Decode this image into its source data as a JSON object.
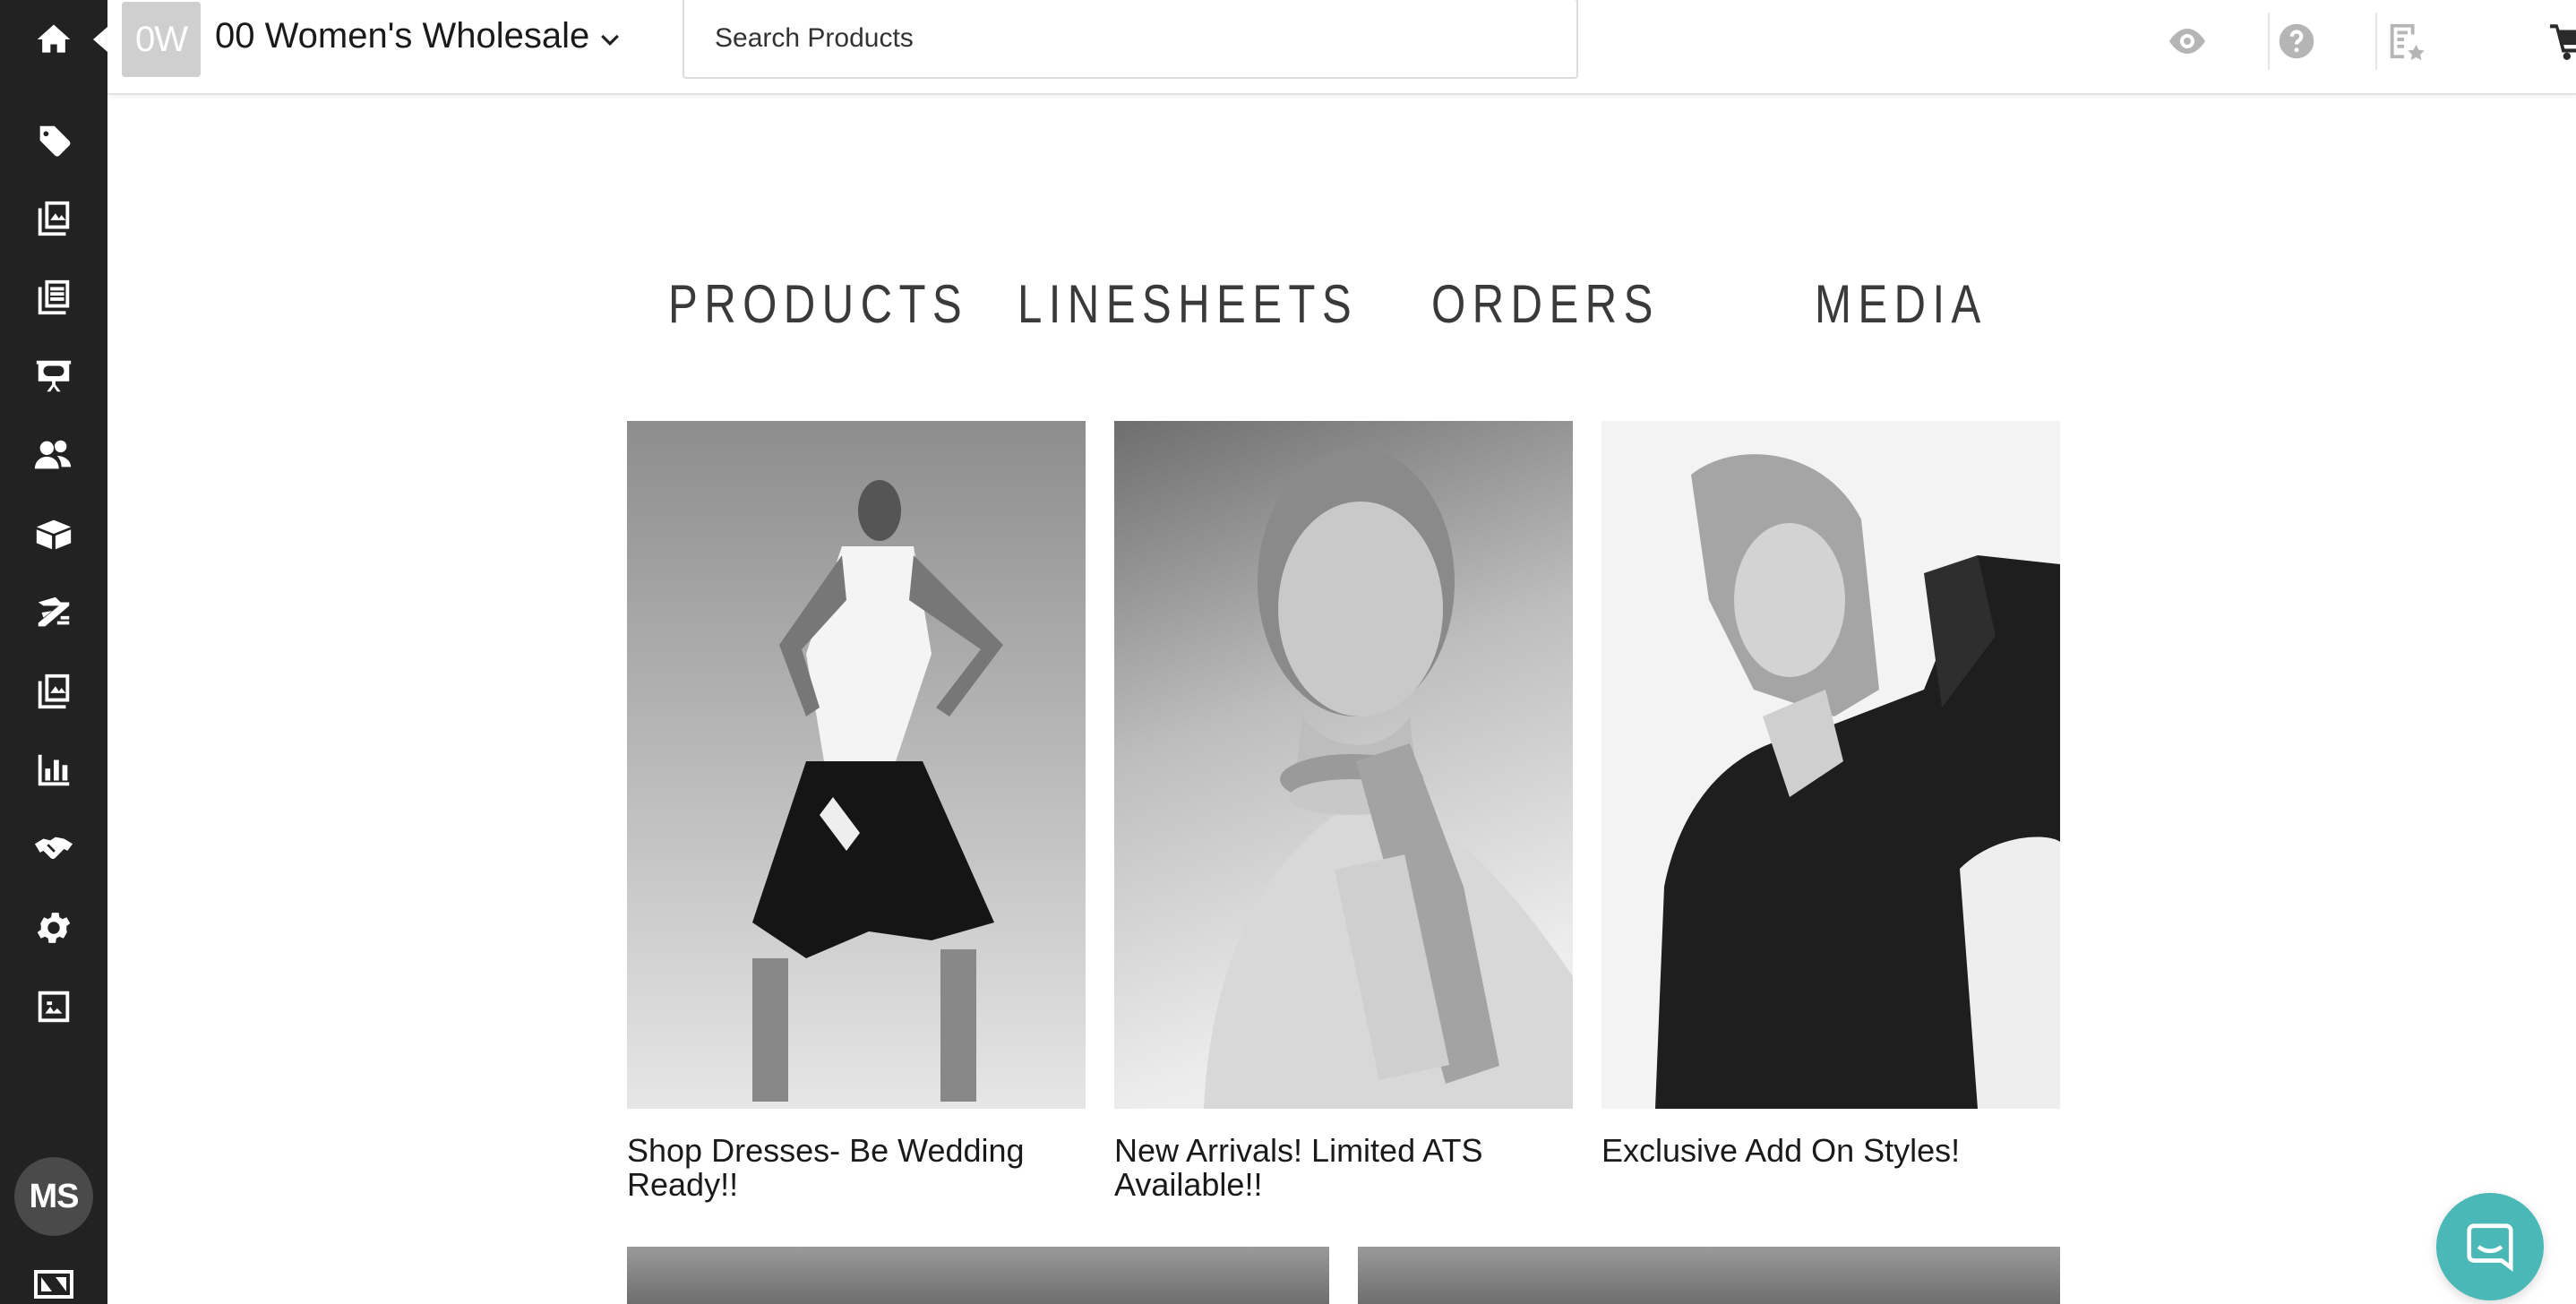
{
  "brand": {
    "initials": "0W",
    "name": "00 Women's Wholesale"
  },
  "search": {
    "placeholder": "Search Products"
  },
  "sidebar": {
    "items": [
      {
        "icon": "tag-icon"
      },
      {
        "icon": "catalog-icon"
      },
      {
        "icon": "linesheet-icon"
      },
      {
        "icon": "presentation-icon"
      },
      {
        "icon": "customers-icon"
      },
      {
        "icon": "inventory-box-icon"
      },
      {
        "icon": "orders-icon"
      },
      {
        "icon": "media-icon"
      },
      {
        "icon": "reports-chart-icon"
      },
      {
        "icon": "handshake-icon"
      },
      {
        "icon": "settings-gear-icon"
      },
      {
        "icon": "brand-portal-icon"
      }
    ],
    "avatar_initials": "MS"
  },
  "header_icons": [
    "eye-icon",
    "help-icon",
    "linesheet-star-icon",
    "cart-icon"
  ],
  "nav": {
    "products": "PRODUCTS",
    "linesheets": "LINESHEETS",
    "orders": "ORDERS",
    "media": "MEDIA"
  },
  "cards": [
    {
      "caption": "Shop Dresses- Be Wedding Ready!!"
    },
    {
      "caption": "New Arrivals! Limited ATS Available!!"
    },
    {
      "caption": "Exclusive Add On Styles!"
    }
  ],
  "colors": {
    "sidebar": "#222222",
    "chat": "#4ab8b6",
    "logo_bg": "#cfcfcf"
  }
}
